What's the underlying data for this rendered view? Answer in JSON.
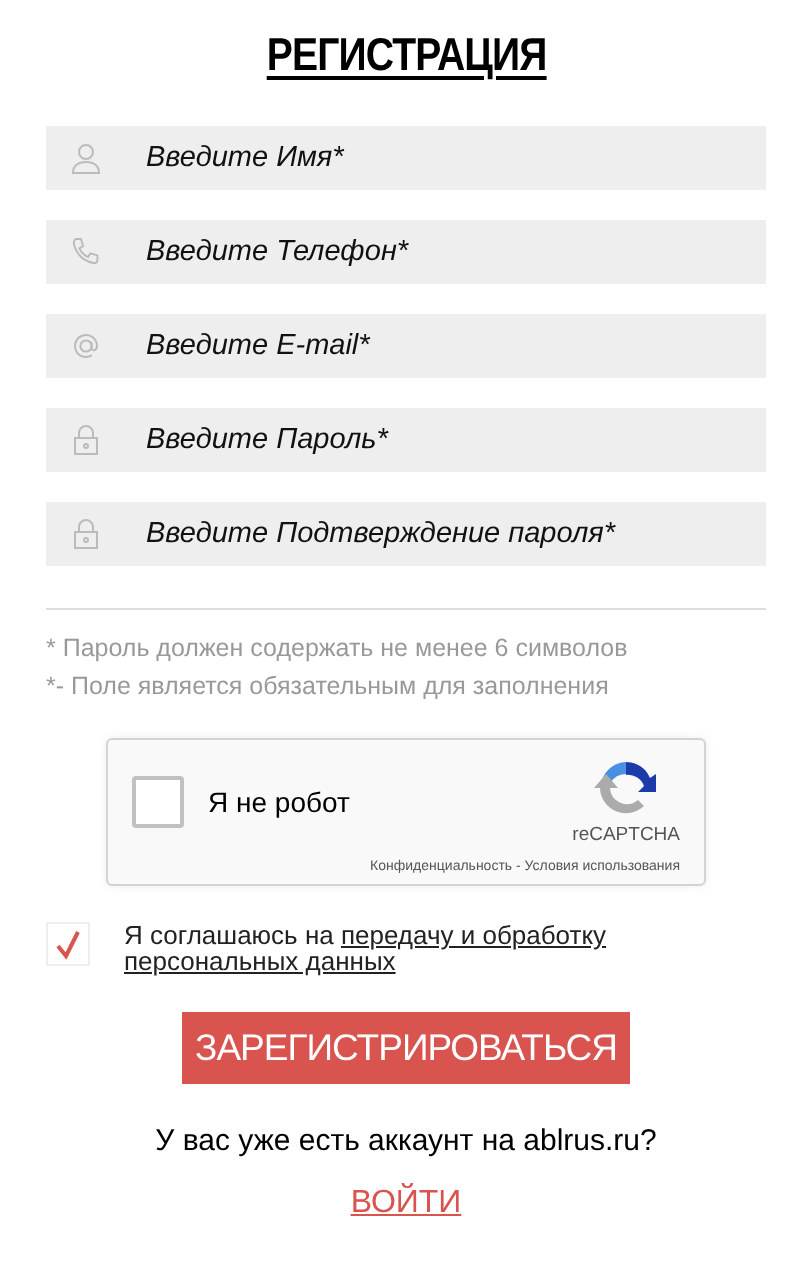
{
  "title": "РЕГИСТРАЦИЯ",
  "fields": [
    {
      "kind": "person",
      "placeholder": "Введите Имя*"
    },
    {
      "kind": "phone",
      "placeholder": "Введите Телефон*"
    },
    {
      "kind": "email",
      "placeholder": "Введите E-mail*"
    },
    {
      "kind": "lock",
      "placeholder": "Введите Пароль*"
    },
    {
      "kind": "lock",
      "placeholder": "Введите Подтверждение пароля*"
    }
  ],
  "notes": [
    "* Пароль должен содержать не менее 6 символов",
    "*- Поле является обязательным для заполнения"
  ],
  "captcha": {
    "label": "Я не робот",
    "checked": false,
    "brand": "reCAPTCHA",
    "links": [
      "Конфиденциальность",
      "Условия использования"
    ],
    "separator": " - "
  },
  "consent": {
    "checked": true,
    "text": "Я соглашаюсь на",
    "link_parts": [
      "передачу и обработку",
      "персональных данных"
    ]
  },
  "submit": "ЗАРЕГИСТРИРОВАТЬСЯ",
  "question": "У вас уже есть аккаунт на ablrus.ru?",
  "login": "ВОЙТИ"
}
